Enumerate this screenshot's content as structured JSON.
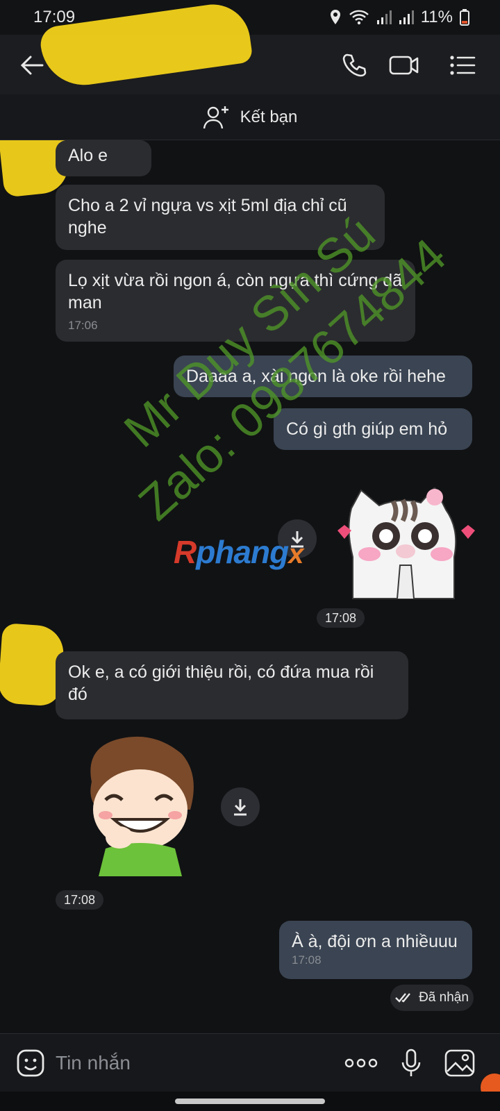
{
  "status_bar": {
    "time": "17:09",
    "battery": "11%"
  },
  "header": {
    "contact_name": ""
  },
  "friend_bar": {
    "label": "Kết bạn"
  },
  "messages": [
    {
      "dir": "in",
      "text": "Alo e"
    },
    {
      "dir": "in",
      "text": "Cho a 2 vỉ ngựa vs xịt 5ml địa chỉ cũ nghe"
    },
    {
      "dir": "in",
      "text": "Lọ xịt vừa rồi ngon á, còn ngựa thì cứng dã man",
      "time": "17:06"
    },
    {
      "dir": "out",
      "text": "Daaaa a, xài ngon là oke rồi hehe"
    },
    {
      "dir": "out",
      "text": "Có gì gth giúp em hỏ"
    },
    {
      "dir": "out",
      "type": "sticker",
      "sticker": "cat-sticker",
      "time": "17:08"
    },
    {
      "dir": "in",
      "text": "Ok e, a có giới thiệu rồi, có đứa mua rồi đó"
    },
    {
      "dir": "in",
      "type": "sticker",
      "sticker": "boy-laughing-sticker",
      "time": "17:08"
    },
    {
      "dir": "out",
      "text": "À à, đội ơn a nhiềuuu",
      "time": "17:08"
    }
  ],
  "received_status": "Đã nhận",
  "watermark": {
    "line1": "Mr Duy Sìn Sú",
    "line2": "Zalo: 0987674844",
    "logo": "Rphangx"
  },
  "composer": {
    "placeholder": "Tin nhắn"
  },
  "icons": [
    "back-icon",
    "phone-icon",
    "video-icon",
    "menu-list-icon",
    "add-friend-icon",
    "download-icon",
    "emoji-icon",
    "more-icon",
    "microphone-icon",
    "image-icon",
    "double-check-icon"
  ]
}
